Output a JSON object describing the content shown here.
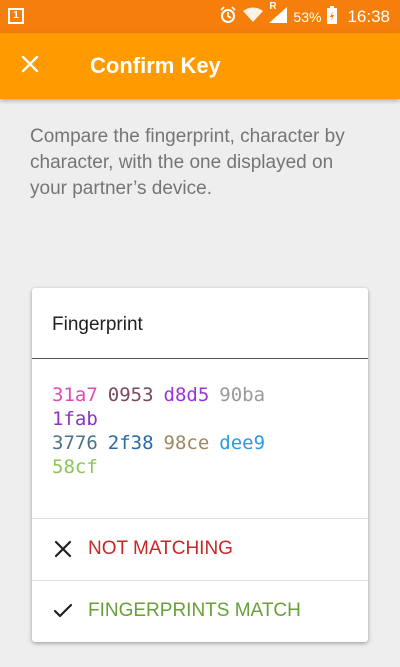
{
  "status_bar": {
    "sim_label": "1",
    "battery_percent": "53%",
    "time": "16:38",
    "network_label": "R"
  },
  "app_bar": {
    "title": "Confirm Key",
    "close_icon": "close-icon",
    "background": "#ff9a00"
  },
  "instructions": "Compare the fingerprint, character by character, with the one displayed on your partner’s device.",
  "card": {
    "title": "Fingerprint",
    "fingerprint_lines": [
      [
        {
          "text": "31a7",
          "color": "#e14bb5"
        },
        {
          "text": "0953",
          "color": "#7a4a5a"
        },
        {
          "text": "d8d5",
          "color": "#9b34d6"
        },
        {
          "text": "90ba",
          "color": "#9a9a9a"
        }
      ],
      [
        {
          "text": "1fab",
          "color": "#8a35c4"
        }
      ],
      [
        {
          "text": "3776",
          "color": "#4b7489"
        },
        {
          "text": "2f38",
          "color": "#2a6aa8"
        },
        {
          "text": "98ce",
          "color": "#9e8760"
        },
        {
          "text": "dee9",
          "color": "#2a9be0"
        }
      ],
      [
        {
          "text": "58cf",
          "color": "#8dc45a"
        }
      ]
    ],
    "actions": {
      "not_matching": {
        "label": "NOT MATCHING",
        "color": "#c62828",
        "icon": "close-icon"
      },
      "match": {
        "label": "FINGERPRINTS MATCH",
        "color": "#689f38",
        "icon": "check-icon"
      }
    }
  }
}
